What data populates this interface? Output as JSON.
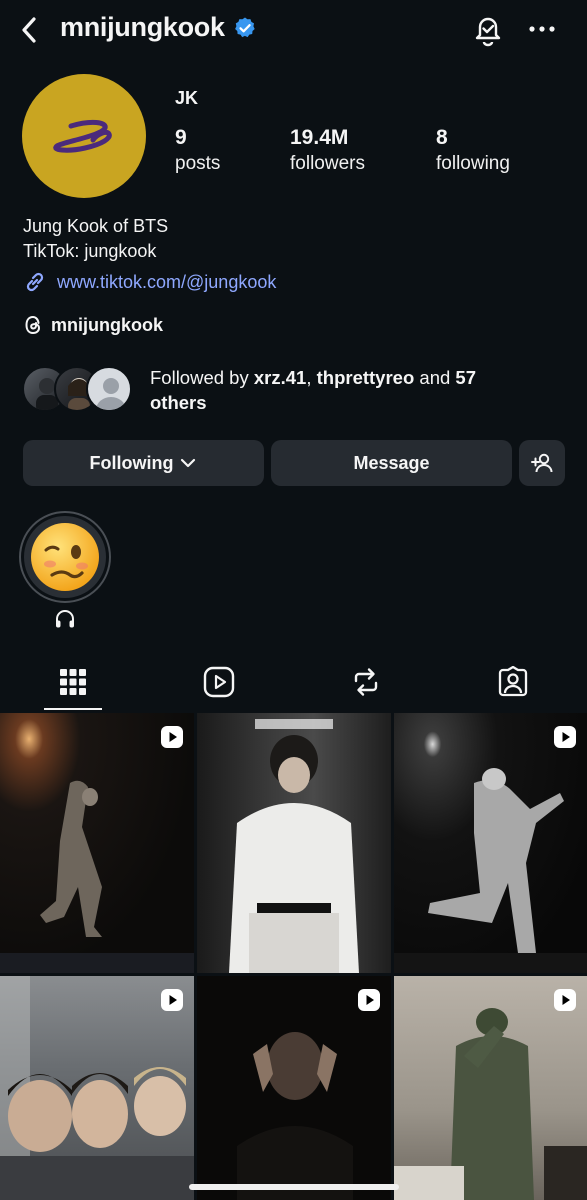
{
  "header": {
    "username": "mnijungkook",
    "verified_icon": "verified-badge-icon",
    "back_icon": "chevron-left-icon",
    "bell_icon": "notification-bell-icon",
    "more_icon": "more-horizontal-icon"
  },
  "profile": {
    "display_name": "JK",
    "stats": [
      {
        "value": "9",
        "label": "posts"
      },
      {
        "value": "19.4M",
        "label": "followers"
      },
      {
        "value": "8",
        "label": "following"
      }
    ],
    "bio_line1": "Jung Kook of BTS",
    "bio_line2": "TikTok: jungkook",
    "link": "www.tiktok.com/@jungkook",
    "threads_handle": "mnijungkook",
    "followed_prefix": "Followed by ",
    "followed_user1": "xrz.41",
    "followed_sep": ", ",
    "followed_user2": "thprettyreo",
    "followed_and": " and ",
    "followed_count": "57",
    "followed_others": "others"
  },
  "actions": {
    "following_label": "Following",
    "message_label": "Message"
  },
  "highlight": {
    "icon": "headphones-icon"
  },
  "tabs": [
    {
      "name": "grid",
      "icon": "grid-icon",
      "active": true
    },
    {
      "name": "reels",
      "icon": "reels-icon"
    },
    {
      "name": "reposts",
      "icon": "repost-icon"
    },
    {
      "name": "tagged",
      "icon": "tagged-person-icon"
    }
  ],
  "colors": {
    "background": "#0b1014",
    "button": "#262b31",
    "link": "#8fa8ff",
    "verified": "#3897f0",
    "avatar": "#c9a521",
    "logo": "#4b2a7c"
  }
}
